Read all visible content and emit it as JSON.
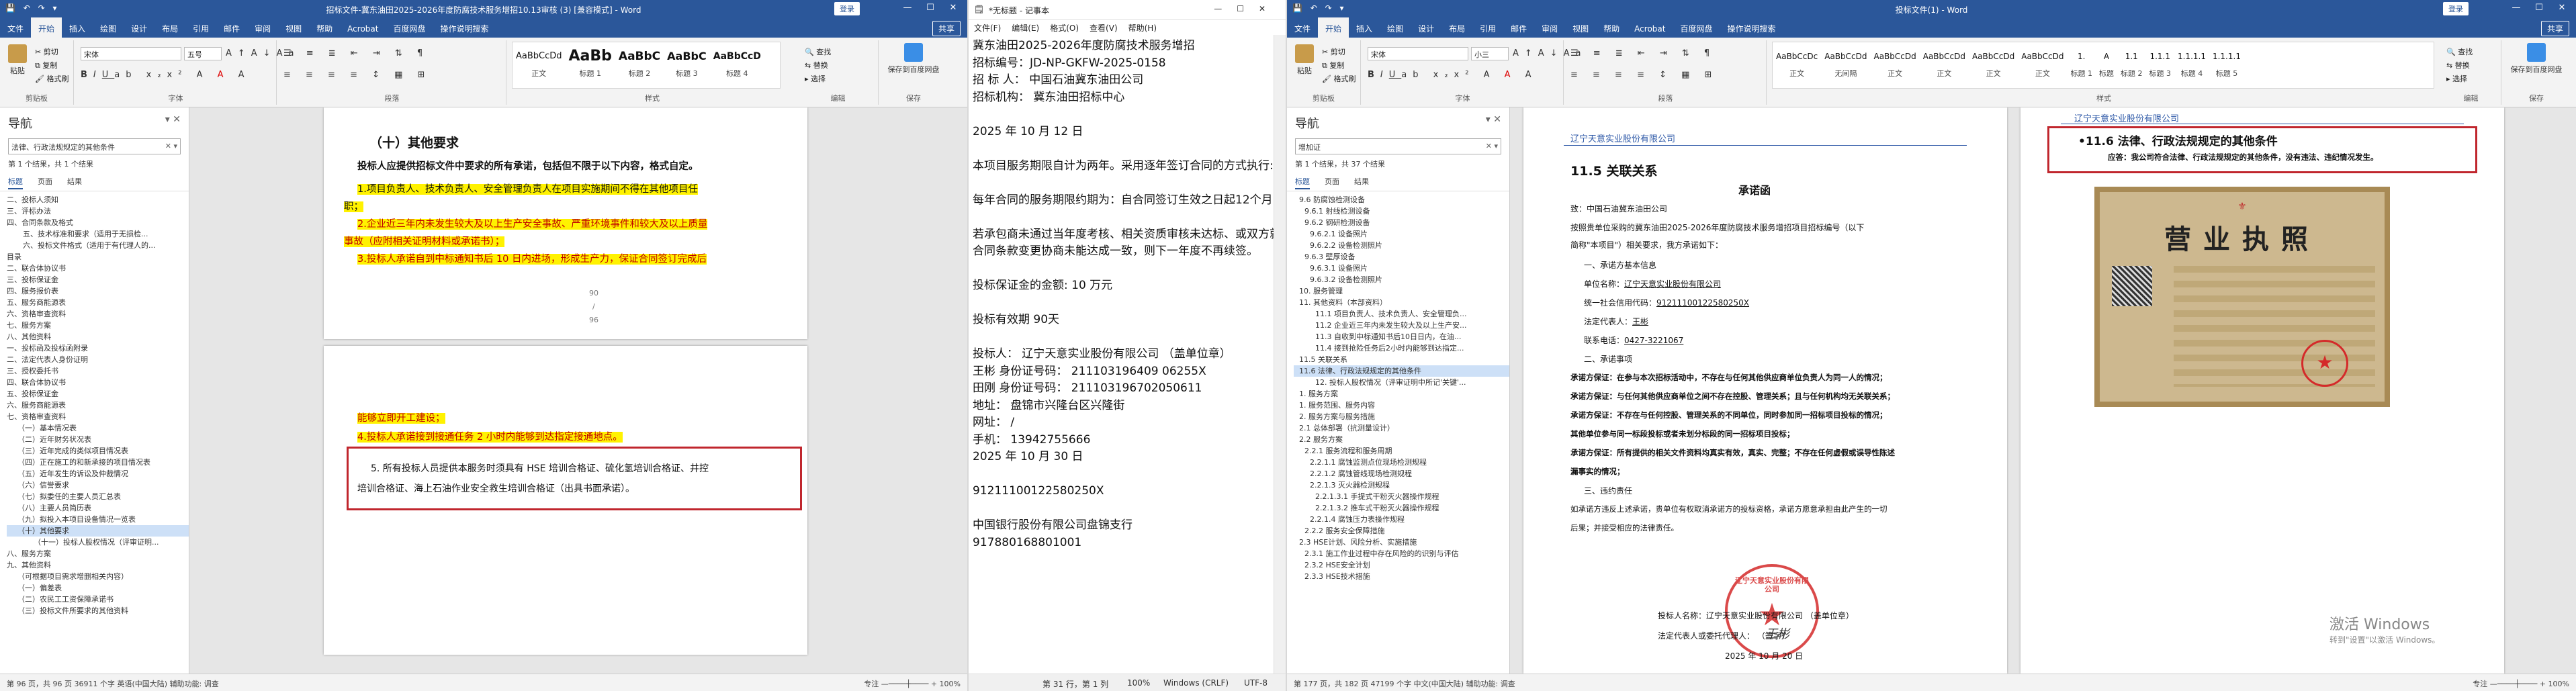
{
  "left_window": {
    "title": "招标文件-冀东油田2025-2026年度防腐技术服务增招10.13审核 (3) [兼容模式] - Word",
    "login_label": "登录",
    "tabs": [
      "文件",
      "开始",
      "插入",
      "绘图",
      "设计",
      "布局",
      "引用",
      "邮件",
      "审阅",
      "视图",
      "帮助",
      "Acrobat",
      "百度网盘",
      "操作说明搜索"
    ],
    "share_label": "共享",
    "ribbon": {
      "paste_label": "粘贴",
      "cut_label": "剪切",
      "copy_label": "复制",
      "format_painter_label": "格式刷",
      "clipboard_group": "剪贴板",
      "font_name": "宋体",
      "font_size": "五号",
      "font_group": "字体",
      "paragraph_group": "段落",
      "styles": [
        {
          "preview": "AaBbCcDd",
          "name": "正文"
        },
        {
          "preview": "AaBb",
          "name": "标题 1"
        },
        {
          "preview": "AaBbC",
          "name": "标题 2"
        },
        {
          "preview": "AaBbC",
          "name": "标题 3"
        },
        {
          "preview": "AaBbCcD",
          "name": "标题 4"
        }
      ],
      "styles_group": "样式",
      "find_label": "查找",
      "replace_label": "替换",
      "select_label": "选择",
      "editing_group": "编辑",
      "save_to_baidu_label": "保存到百度网盘",
      "save_group": "保存"
    },
    "nav": {
      "heading": "导航",
      "search_value": "法律、行政法规规定的其他条件",
      "result_count": "第 1 个结果，共 1 个结果",
      "tabs": [
        "标题",
        "页面",
        "结果"
      ],
      "items": [
        "二、投标人须知",
        "三、评标办法",
        "四、合同条款及格式",
        "五、技术标准和要求（适用于无损检...",
        "六、投标文件格式（适用于有代理人的...",
        "目录",
        "二、联合体协议书",
        "三、投标保证金",
        "四、服务报价表",
        "五、服务商能源表",
        "六、资格审查资料",
        "七、服务方案",
        "八、其他资料",
        "一、投标函及投标函附录",
        "二、法定代表人身份证明",
        "三、授权委托书",
        "四、联合体协议书",
        "五、投标保证金",
        "六、服务商能源表",
        "七、资格审查资料",
        "（一）基本情况表",
        "（二）近年财务状况表",
        "（三）近年完成的类似项目情况表",
        "（四）正在施工的和新承接的项目情况表",
        "（五）近年发生的诉讼及仲裁情况",
        "（六）信誉要求",
        "（七）拟委任的主要人员汇总表",
        "（八）主要人员简历表",
        "（九）拟投入本项目设备情况一览表",
        "（十）其他要求",
        "（十一）投标人股权情况（评审证明...",
        "八、服务方案",
        "九、其他资料",
        "（可根据项目需求增删相关内容）",
        "（一）偏差表",
        "（二）农民工工资保障承诺书",
        "（三）投标文件所要求的其他资料"
      ],
      "selected_index": 29
    },
    "doc": {
      "section_heading": "（十）其他要求",
      "intro": "投标人应提供招标文件中要求的所有承诺，包括但不限于以下内容，格式自定。",
      "item1": "1.项目负责人、技术负责人、安全管理负责人在项目实施期间不得在其他项目任",
      "item1b": "职；",
      "item2": "2.企业近三年内未发生较大及以上生产安全事故、严重环境事件和较大及以上质量",
      "item2b": "事故（应附相关证明材料或承诺书）；",
      "item3": "3.投标人承诺自到中标通知书后 10 日内进场，形成生产力，保证合同签订完成后",
      "page_num_top": "90",
      "page_sep": "/",
      "page_num_bottom": "96",
      "cont1": "能够立即开工建设；",
      "item4": "4.投标人承诺接到接通任务 2 小时内能够到达指定接通地点。",
      "item5a": "5. 所有投标人员提供本服务时须具有 HSE 培训合格证、硫化氢培训合格证、井控",
      "item5b": "培训合格证、海上石油作业安全救生培训合格证（出具书面承诺）。"
    },
    "status": "第 96 页，共 96 页    36911 个字    英语(中国大陆)    辅助功能: 调查",
    "status_right": "专注        —────┼──── +   100%",
    "zoom": "100%"
  },
  "notepad": {
    "title": "*无标题 - 记事本",
    "menu": [
      "文件(F)",
      "编辑(E)",
      "格式(O)",
      "查看(V)",
      "帮助(H)"
    ],
    "lines": [
      "冀东油田2025-2026年度防腐技术服务增招",
      "招标编号：JD-NP-GKFW-2025-0158",
      "招 标 人：  中国石油冀东油田公司",
      "招标机构：  冀东油田招标中心",
      "",
      " 2025 年 10 月 12 日",
      "",
      "本项目服务期限自计为两年。采用逐年签订合同的方式执行:",
      "",
      "每年合同的服务期限约期为：自合同签订生效之日起12个月:",
      "",
      "若承包商未通过当年度考核、相关资质审核未达标、或双方就",
      "合同条款变更协商未能达成一致，则下一年度不再续签。",
      "",
      "投标保证金的金额:  10 万元",
      "",
      "投标有效期  90天",
      "",
      "投标人：   辽宁天意实业股份有限公司   （盖单位章）",
      "王彬   身份证号码：   211103196409 06255X",
      "田刚   身份证号码：   211103196702050611",
      "地址：   盘锦市兴隆台区兴隆街",
      "网址：              /",
      "手机：         13942755666",
      "2025 年 10 月 30 日",
      "",
      "91211100122580250X",
      "",
      "中国银行股份有限公司盘锦支行",
      "917880168801001"
    ],
    "status_pos": "第 31 行，第 1 列",
    "status_zoom": "100%",
    "status_eol": "Windows (CRLF)",
    "status_enc": "UTF-8"
  },
  "right_window": {
    "title": "投标文件(1) - Word",
    "login_label": "登录",
    "tabs": [
      "文件",
      "开始",
      "插入",
      "绘图",
      "设计",
      "布局",
      "引用",
      "邮件",
      "审阅",
      "视图",
      "帮助",
      "Acrobat",
      "百度网盘",
      "操作说明搜索"
    ],
    "share_label": "共享",
    "ribbon": {
      "paste_label": "粘贴",
      "cut_label": "剪切",
      "copy_label": "复制",
      "format_painter_label": "格式刷",
      "clipboard_group": "剪贴板",
      "font_name": "宋体",
      "font_size": "小三",
      "font_group": "字体",
      "paragraph_group": "段落",
      "styles": [
        {
          "preview": "AaBbCcDc",
          "name": "正文"
        },
        {
          "preview": "AaBbCcDd",
          "name": "无间隔"
        },
        {
          "preview": "AaBbCcDd",
          "name": "正文"
        },
        {
          "preview": "AaBbCcDd",
          "name": "正文"
        },
        {
          "preview": "AaBbCcDd",
          "name": "正文"
        },
        {
          "preview": "AaBbCcDd",
          "name": "正文"
        },
        {
          "preview": "1.",
          "name": "标题 1"
        },
        {
          "preview": "A",
          "name": "标题"
        },
        {
          "preview": "1.1",
          "name": "标题 2"
        },
        {
          "preview": "1.1.1",
          "name": "标题 3"
        },
        {
          "preview": "1.1.1.1",
          "name": "标题 4"
        },
        {
          "preview": "1.1.1.1",
          "name": "标题 5"
        }
      ],
      "styles_group": "样式",
      "find_label": "查找",
      "replace_label": "替换",
      "select_label": "选择",
      "editing_group": "编辑",
      "save_to_baidu_label": "保存到百度网盘",
      "save_group": "保存"
    },
    "nav": {
      "heading": "导航",
      "search_value": "增加证",
      "result_count": "第 1 个结果，共 37 个结果",
      "tabs": [
        "标题",
        "页面",
        "结果"
      ],
      "items": [
        "9.6 防腐蚀检测设备",
        "9.6.1 射线检测设备",
        "9.6.2 钢研检测设备",
        "9.6.2.1 设备照片",
        "9.6.2.2 设备检测照片",
        "9.6.3 壁厚设备",
        "9.6.3.1 设备照片",
        "9.6.3.2 设备检测照片",
        "10. 服务管理",
        "11. 其他资料（本部资料）",
        "11.1 项目负责人、技术负责人、安全管理负...",
        "11.2 企业近三年内未发生较大及以上生产安...",
        "11.3 自收到中标通知书后10日日内，在油...",
        "11.4 接到抢险任务后2小时内能够到达指定...",
        "11.5 关联关系",
        "11.6 法律、行政法规规定的其他条件",
        "12. 投标人股权情况（评审证明中所记'关键'...",
        "1. 服务方案",
        "1. 服务范围、服务内容",
        "2. 服务方案与服务措施",
        "2.1 总体部署（抗测量设计）",
        "2.2 服务方案",
        "2.2.1 服务流程和服务周期",
        "2.2.1.1 腐蚀监测点位现场检测规程",
        "2.2.1.2 腐蚀管线现场检测规程",
        "2.2.1.3 灭火器检测规程",
        "2.2.1.3.1 手提式干粉灭火器操作规程",
        "2.2.1.3.2 推车式干粉灭火器操作规程",
        "2.2.1.4 腐蚀压力表操作规程",
        "2.2.2 服务安全保障措施",
        "2.3 HSE计划、风险分析、实施措施",
        "2.3.1 施工作业过程中存在风险的的识别与评估",
        "2.3.2 HSE安全计划",
        "2.3.3 HSE技术措施"
      ],
      "selected_index": 15
    },
    "page1": {
      "header": "辽宁天意实业股份有限公司",
      "section": "11.5  关联关系",
      "title": "承诺函",
      "to": "致：中国石油冀东油田公司",
      "intro": "    按照贵单位采购的冀东油田2025-2026年度防腐技术服务增招项目招标编号（以下",
      "intro2": "简称\"本项目\"）相关要求，我方承诺如下：",
      "s1": "一、承诺方基本信息",
      "unit_label": "单位名称：",
      "unit": "辽宁天意实业股份有限公司",
      "code_label": "统一社会信用代码：",
      "code": "91211100122580250X",
      "rep_label": "法定代表人：",
      "rep": "王彬",
      "phone_label": "联系电话：",
      "phone": "0427-3221067",
      "s2": "二、承诺事项",
      "p1": "    承诺方保证：在参与本次招标活动中，不存在与任何其他供应商单位负责人为同一人的情况；",
      "p2": "    承诺方保证：与任何其他供应商单位之间不存在控股、管理关系；且与任何机构均无关联关系；",
      "p3": "    承诺方保证：不存在与任何控股、管理关系的不同单位，同时参加同一招标项目投标的情况；",
      "p4": "其他单位参与同一标段投标或者未划分标段的同一招标项目投标；",
      "p5": "    承诺方保证：所有提供的相关文件资料均真实有效，真实、完整；不存在任何虚假或误导性陈述",
      "p6": "漏事实的情况；",
      "s3": "三、违约责任",
      "p7": "    如承诺方违反上述承诺，贵单位有权取消承诺方的投标资格，承诺方愿意承担由此产生的一切",
      "p8": "后果；并接受相应的法律责任。",
      "sign1": "投标人名称：辽宁天意实业股份有限公司       （盖单位章）",
      "sign2": "法定代表人或委托代理人：                  （签字）",
      "date": "2025 年 10 月 20 日",
      "seal_text": "辽宁天意实业股份有限公司"
    },
    "page2": {
      "header": "辽宁天意实业股份有限公司",
      "section": "•11.6  法律、行政法规规定的其他条件",
      "note": "应答：我公司符合法律、行政法规规定的其他条件，没有违法、违纪情况发生。",
      "license_title": "营业执照",
      "activate_line1": "激活 Windows",
      "activate_line2": "转到\"设置\"以激活 Windows。"
    },
    "status": "第 177 页，共 182 页    47199 个字    中文(中国大陆)    辅助功能: 调查",
    "status_right": "专注        —────┼──── +   100%"
  }
}
